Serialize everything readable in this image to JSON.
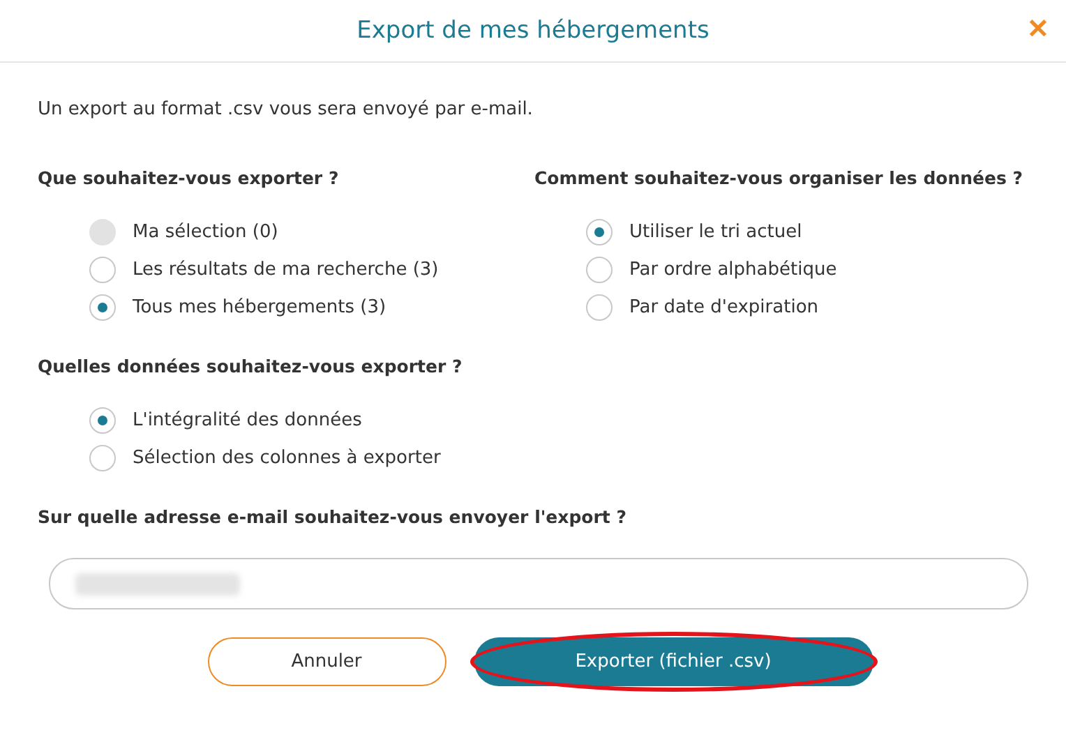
{
  "window": {
    "title": "Export de mes hébergements",
    "close": "✕"
  },
  "intro": "Un export au format .csv vous sera envoyé par e-mail.",
  "sections": [
    {
      "question": "Que souhaitez-vous exporter ?",
      "options": [
        {
          "label": "Ma sélection (0)",
          "selected": false,
          "disabled": true
        },
        {
          "label": "Les résultats de ma recherche (3)",
          "selected": false,
          "disabled": false
        },
        {
          "label": "Tous mes hébergements (3)",
          "selected": true,
          "disabled": false
        }
      ]
    },
    {
      "question": "Comment souhaitez-vous organiser les données ?",
      "options": [
        {
          "label": "Utiliser le tri actuel",
          "selected": true,
          "disabled": false
        },
        {
          "label": "Par ordre alphabétique",
          "selected": false,
          "disabled": false
        },
        {
          "label": "Par date d'expiration",
          "selected": false,
          "disabled": false
        }
      ]
    },
    {
      "question": "Quelles données souhaitez-vous exporter ?",
      "options": [
        {
          "label": "L'intégralité des données",
          "selected": true,
          "disabled": false
        },
        {
          "label": "Sélection des colonnes à exporter",
          "selected": false,
          "disabled": false
        }
      ]
    }
  ],
  "email": {
    "question": "Sur quelle adresse e-mail souhaitez-vous envoyer l'export ?",
    "redacted": true
  },
  "buttons": [
    {
      "label": "Annuler",
      "kind": "secondary",
      "highlighted": false
    },
    {
      "label": "Exporter (fichier .csv)",
      "kind": "primary",
      "highlighted": true
    }
  ]
}
